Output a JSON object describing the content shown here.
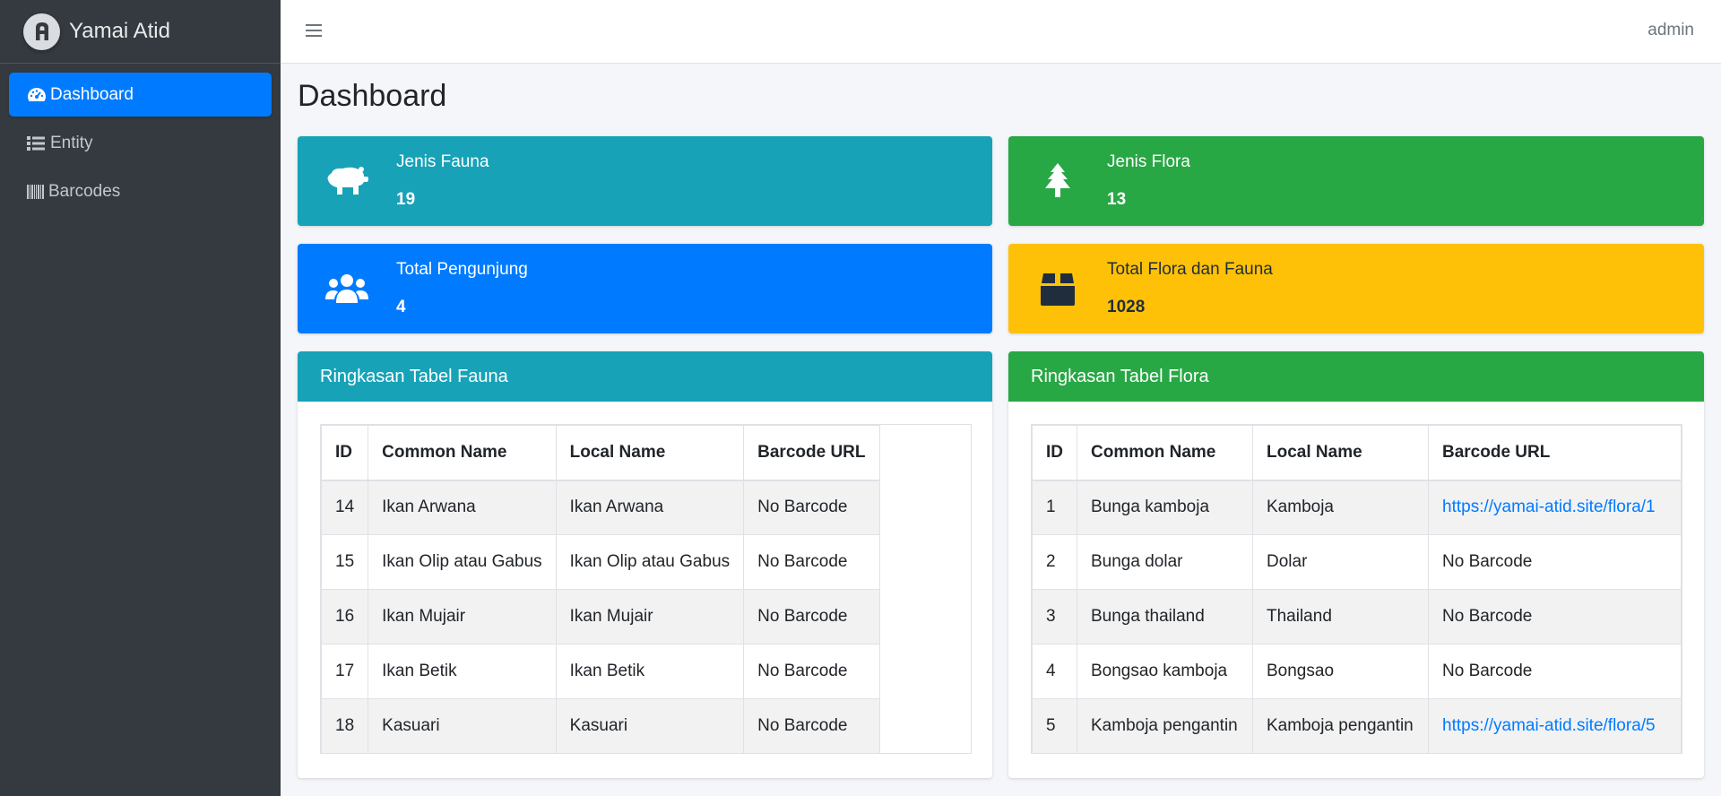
{
  "brand": {
    "name": "Yamai Atid",
    "logo_icon": "logo-icon"
  },
  "sidebar": {
    "items": [
      {
        "label": "Dashboard",
        "icon": "tachometer-icon",
        "active": true
      },
      {
        "label": "Entity",
        "icon": "list-icon",
        "active": false
      },
      {
        "label": "Barcodes",
        "icon": "barcode-icon",
        "active": false
      }
    ]
  },
  "topbar": {
    "user": "admin"
  },
  "page": {
    "title": "Dashboard"
  },
  "info_boxes": [
    {
      "label": "Jenis Fauna",
      "value": "19",
      "icon": "hippo-icon",
      "color": "#17a2b8"
    },
    {
      "label": "Jenis Flora",
      "value": "13",
      "icon": "tree-icon",
      "color": "#28a745"
    },
    {
      "label": "Total Pengunjung",
      "value": "4",
      "icon": "users-icon",
      "color": "#007bff"
    },
    {
      "label": "Total Flora dan Fauna",
      "value": "1028",
      "icon": "box-icon",
      "color": "#ffc107"
    }
  ],
  "fauna_table": {
    "title": "Ringkasan Tabel Fauna",
    "columns": [
      "ID",
      "Common Name",
      "Local Name",
      "Barcode URL"
    ],
    "rows": [
      [
        "14",
        "Ikan Arwana",
        "Ikan Arwana",
        "No Barcode"
      ],
      [
        "15",
        "Ikan Olip atau Gabus",
        "Ikan Olip atau Gabus",
        "No Barcode"
      ],
      [
        "16",
        "Ikan Mujair",
        "Ikan Mujair",
        "No Barcode"
      ],
      [
        "17",
        "Ikan Betik",
        "Ikan Betik",
        "No Barcode"
      ],
      [
        "18",
        "Kasuari",
        "Kasuari",
        "No Barcode"
      ]
    ]
  },
  "flora_table": {
    "title": "Ringkasan Tabel Flora",
    "columns": [
      "ID",
      "Common Name",
      "Local Name",
      "Barcode URL"
    ],
    "rows": [
      [
        "1",
        "Bunga kamboja",
        "Kamboja",
        "https://yamai-atid.site/flora/1"
      ],
      [
        "2",
        "Bunga dolar",
        "Dolar",
        "No Barcode"
      ],
      [
        "3",
        "Bunga thailand",
        "Thailand",
        "No Barcode"
      ],
      [
        "4",
        "Bongsao kamboja",
        "Bongsao",
        "No Barcode"
      ],
      [
        "5",
        "Kamboja pengantin",
        "Kamboja pengantin",
        "https://yamai-atid.site/flora/5"
      ]
    ]
  },
  "colors": {
    "sidebar_bg": "#343a40",
    "accent": "#007bff",
    "link": "#007bff"
  }
}
